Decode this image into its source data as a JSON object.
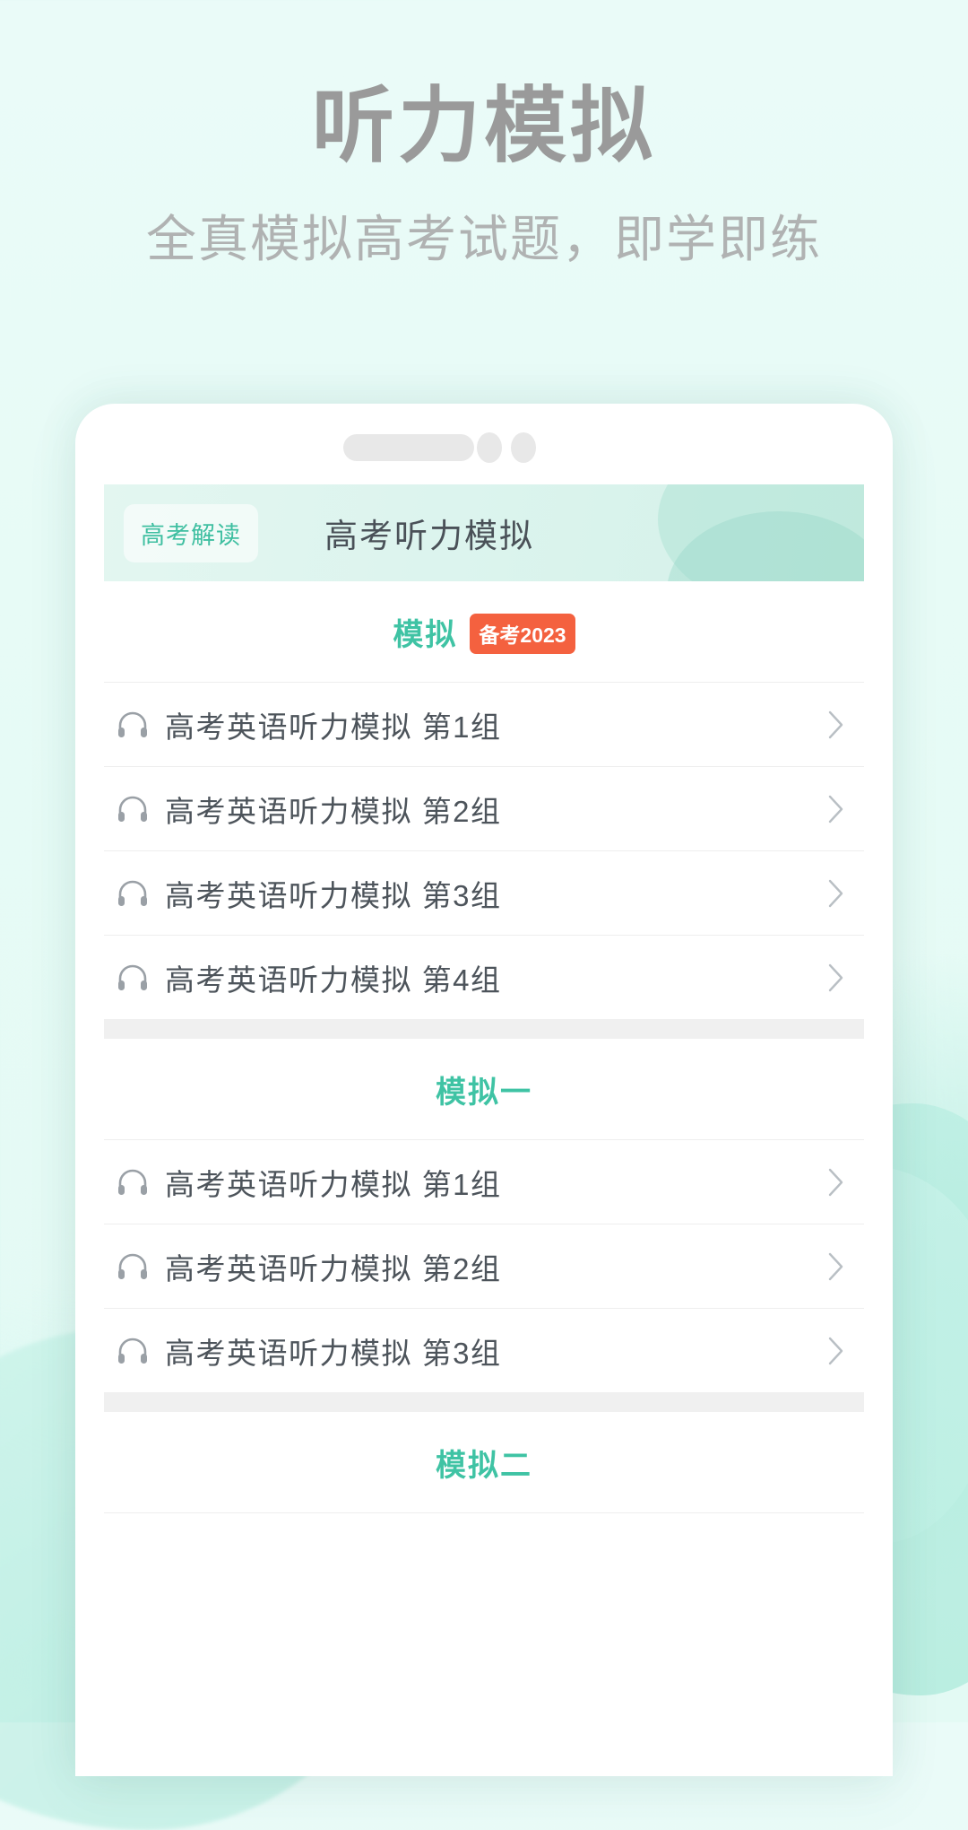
{
  "hero": {
    "title": "听力模拟",
    "subtitle": "全真模拟高考试题，即学即练"
  },
  "colors": {
    "page_bg": "#e7fbf6",
    "hero_title": "#9a9a9a",
    "hero_subtitle": "#b0b2b2",
    "accent_teal": "#3fc3a4",
    "badge_orange": "#f4613f",
    "row_text": "#4d545b",
    "tab_title": "#4a5158"
  },
  "phone": {
    "capsule": {
      "pill_name": "capsule-pill",
      "dots": 2
    },
    "tab_header": {
      "badge": "高考解读",
      "title": "高考听力模拟"
    },
    "sections": [
      {
        "title": "模拟",
        "badge": "备考2023",
        "rows": [
          {
            "icon": "headphone-icon",
            "label": "高考英语听力模拟 第1组",
            "chevron": "chevron-right-icon"
          },
          {
            "icon": "headphone-icon",
            "label": "高考英语听力模拟 第2组",
            "chevron": "chevron-right-icon"
          },
          {
            "icon": "headphone-icon",
            "label": "高考英语听力模拟 第3组",
            "chevron": "chevron-right-icon"
          },
          {
            "icon": "headphone-icon",
            "label": "高考英语听力模拟 第4组",
            "chevron": "chevron-right-icon"
          }
        ]
      },
      {
        "title": "模拟一",
        "badge": "",
        "rows": [
          {
            "icon": "headphone-icon",
            "label": "高考英语听力模拟 第1组",
            "chevron": "chevron-right-icon"
          },
          {
            "icon": "headphone-icon",
            "label": "高考英语听力模拟 第2组",
            "chevron": "chevron-right-icon"
          },
          {
            "icon": "headphone-icon",
            "label": "高考英语听力模拟 第3组",
            "chevron": "chevron-right-icon"
          }
        ]
      },
      {
        "title": "模拟二",
        "badge": "",
        "rows": []
      }
    ]
  }
}
